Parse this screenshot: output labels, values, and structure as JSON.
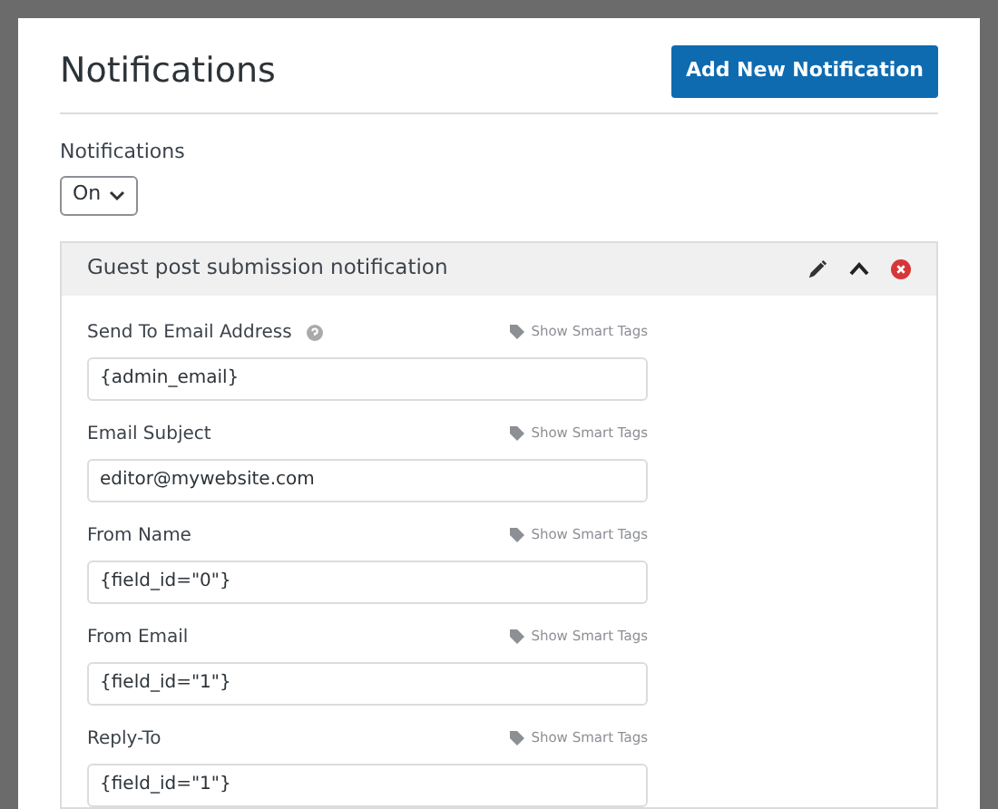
{
  "header": {
    "title": "Notifications",
    "add_button": "Add New Notification"
  },
  "toggle": {
    "label": "Notifications",
    "value": "On"
  },
  "card": {
    "title": "Guest post submission notification",
    "expanded": true,
    "fields": [
      {
        "label": "Send To Email Address",
        "help": true,
        "smart_tags": "Show Smart Tags",
        "value": "{admin_email}"
      },
      {
        "label": "Email Subject",
        "help": false,
        "smart_tags": "Show Smart Tags",
        "value": "editor@mywebsite.com"
      },
      {
        "label": "From Name",
        "help": false,
        "smart_tags": "Show Smart Tags",
        "value": "{field_id=\"0\"}"
      },
      {
        "label": "From Email",
        "help": false,
        "smart_tags": "Show Smart Tags",
        "value": "{field_id=\"1\"}"
      },
      {
        "label": "Reply-To",
        "help": false,
        "smart_tags": "Show Smart Tags",
        "value": "{field_id=\"1\"}"
      }
    ]
  }
}
